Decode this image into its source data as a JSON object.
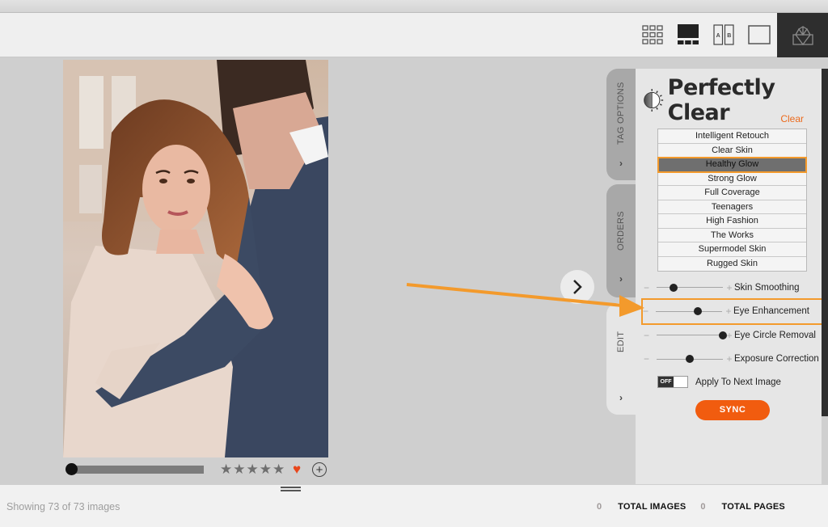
{
  "toolbar": {
    "view_modes": [
      {
        "name": "grid-view",
        "icon": "grid-icon"
      },
      {
        "name": "filmstrip-view",
        "icon": "filmstrip-icon"
      },
      {
        "name": "compare-view",
        "icon": "compare-ab-icon",
        "labels": [
          "A",
          "B"
        ]
      },
      {
        "name": "single-view",
        "icon": "single-view-icon"
      }
    ],
    "logo_icon": "perfectly-clear-logo-icon"
  },
  "photo": {
    "rating_stars": 0,
    "rating_max": 5,
    "favorite": true,
    "add_symbol": "+"
  },
  "side_tabs": [
    {
      "label": "TAG OPTIONS",
      "chevron": "›"
    },
    {
      "label": "ORDERS",
      "chevron": "›"
    },
    {
      "label": "EDIT",
      "chevron": "›"
    }
  ],
  "panel": {
    "brand": "Perfectly Clear",
    "clear_label": "Clear",
    "presets": [
      "Intelligent Retouch",
      "Clear Skin",
      "Healthy Glow",
      "Strong Glow",
      "Full Coverage",
      "Teenagers",
      "High Fashion",
      "The Works",
      "Supermodel Skin",
      "Rugged Skin"
    ],
    "active_preset": "Healthy Glow",
    "sliders": [
      {
        "label": "Skin Smoothing",
        "value": 0.25
      },
      {
        "label": "Eye Enhancement",
        "value": 0.63,
        "highlighted": true
      },
      {
        "label": "Eye Circle Removal",
        "value": 1.0
      },
      {
        "label": "Exposure Correction",
        "value": 0.5
      }
    ],
    "apply_toggle": {
      "state": "OFF",
      "label": "Apply To Next Image"
    },
    "sync_label": "SYNC"
  },
  "footer": {
    "showing": "Showing 73 of 73 images",
    "total_images_count": "0",
    "total_images_label": "TOTAL IMAGES",
    "total_pages_count": "0",
    "total_pages_label": "TOTAL PAGES"
  },
  "colors": {
    "accent_orange": "#f15c0f",
    "highlight_orange": "#f39a2c",
    "heart": "#e8461b"
  }
}
